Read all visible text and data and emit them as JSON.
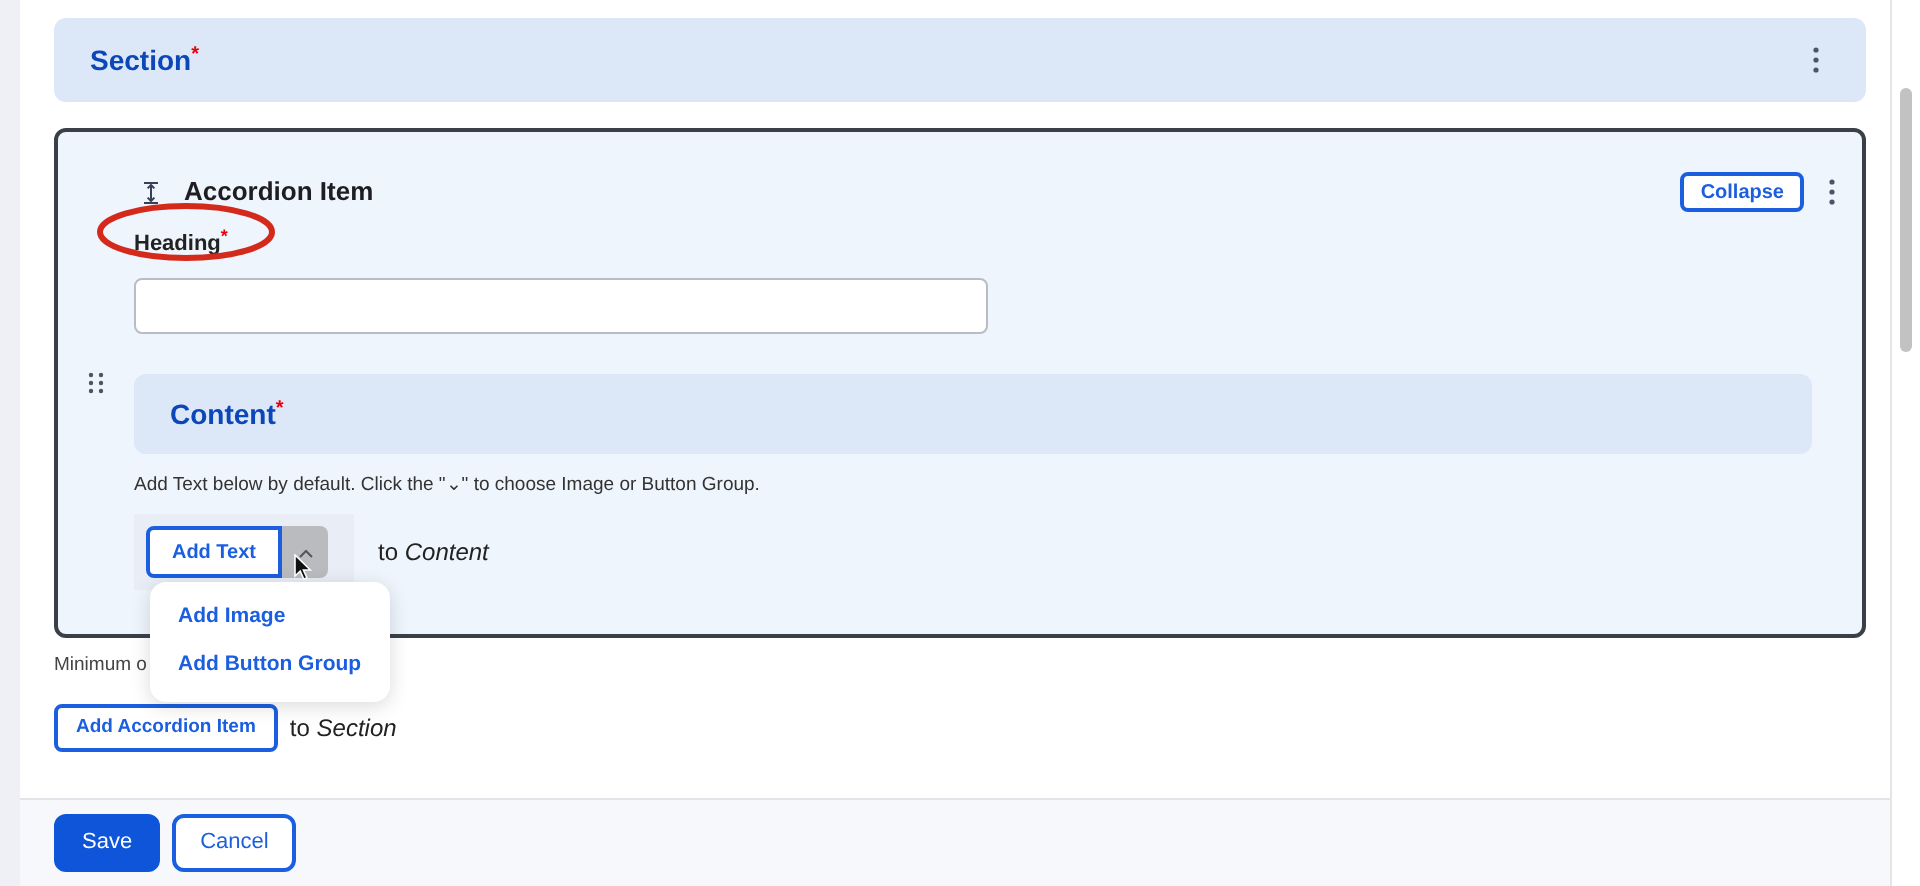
{
  "section": {
    "title": "Section",
    "required_mark": "*"
  },
  "accordion_item": {
    "title": "Accordion Item",
    "collapse_button": "Collapse",
    "heading_label": "Heading",
    "heading_required_mark": "*",
    "content": {
      "title": "Content",
      "required_mark": "*"
    },
    "help_text": "Add Text below by default. Click the \"⌄\" to choose Image or Button Group.",
    "add_button": "Add Text",
    "target_prefix": "to",
    "target": "Content",
    "menu_expanded": true,
    "menu_items": [
      "Add Image",
      "Add Button Group"
    ]
  },
  "minimum_note": "Minimum o",
  "add_item_button": "Add Accordion Item",
  "add_item_prefix": "to",
  "add_item_target": "Section",
  "footer": {
    "buttons": [
      {
        "label": "Save",
        "kind": "primary"
      },
      {
        "label": "Cancel",
        "kind": "secondary"
      }
    ]
  }
}
